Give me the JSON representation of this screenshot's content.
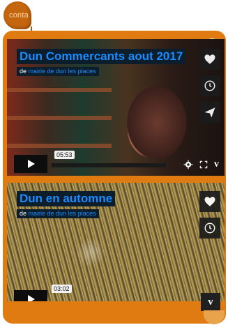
{
  "tab": {
    "label": "conta"
  },
  "videos": [
    {
      "title": "Dun Commercants aout 2017",
      "by_prefix": "de",
      "author": "mairie de dun les places",
      "duration": "05:53"
    },
    {
      "title": "Dun en automne",
      "by_prefix": "de",
      "author": "mairie de dun les places",
      "duration": "03:02"
    }
  ],
  "icons": {
    "like": "heart-icon",
    "watch_later": "clock-icon",
    "share": "send-icon",
    "play": "play-icon",
    "settings": "gear-icon",
    "fullscreen": "fullscreen-icon",
    "vimeo": "vimeo-logo-icon"
  },
  "branding": {
    "vimeo_letter": "v"
  },
  "colors": {
    "frame": "#e07b12",
    "title_text": "#1a8cff",
    "title_bg": "#0c1d2c"
  }
}
